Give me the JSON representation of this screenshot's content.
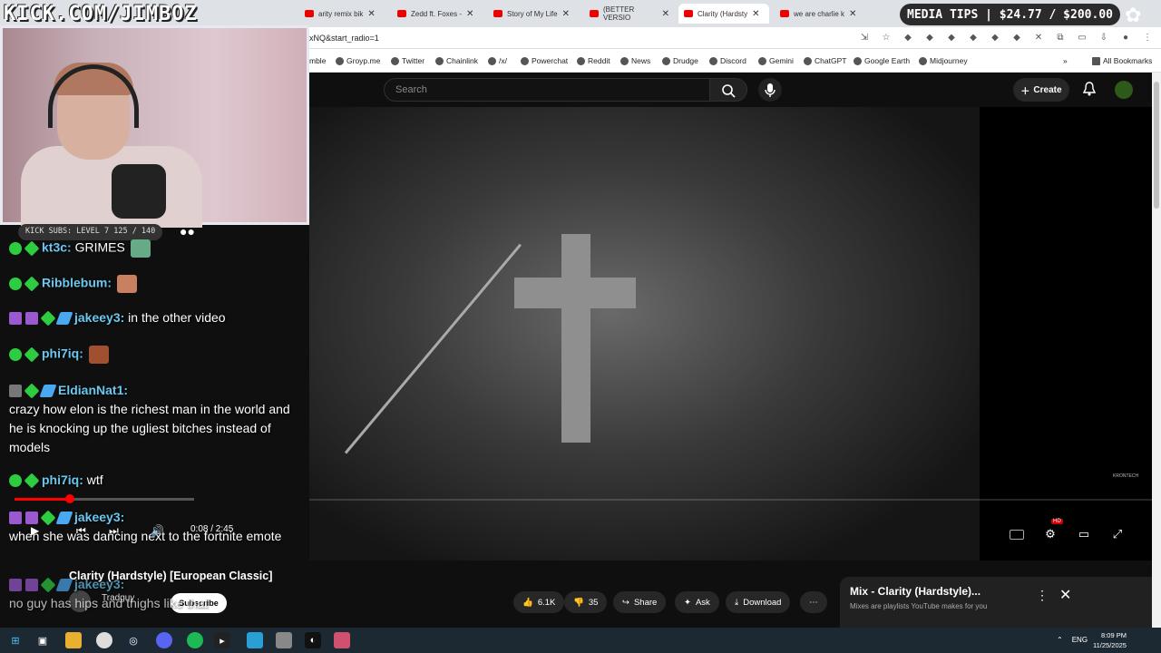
{
  "browser": {
    "tabs": [
      {
        "title": "arity remix bik",
        "active": false
      },
      {
        "title": "Zedd ft. Foxes -",
        "active": false
      },
      {
        "title": "Story of My Life",
        "active": false
      },
      {
        "title": "(BETTER VERSIO",
        "active": false
      },
      {
        "title": "Clarity (Hardsty",
        "active": true
      },
      {
        "title": "we are charlie k",
        "active": false
      }
    ],
    "url": "xNQ&start_radio=1",
    "bookmarks": [
      "mble",
      "Groyp.me",
      "Twitter",
      "Chainlink",
      "/x/",
      "Powerchat",
      "Reddit",
      "News",
      "Drudge",
      "Discord",
      "Gemini",
      "ChatGPT",
      "Google Earth",
      "Midjourney"
    ],
    "all_bookmarks": "All Bookmarks"
  },
  "overlay": {
    "kick_url": "KICK.COM/JIMBOZ",
    "media_tips": "MEDIA TIPS | $24.77 / $200.00",
    "subs_goal": "KICK SUBS: LEVEL 7 125 / 140"
  },
  "youtube": {
    "search_placeholder": "Search",
    "create_label": "Create",
    "video_title": "Clarity (Hardstyle) [European Classic]",
    "channel": "Tradguy",
    "subscribe": "Subscribe",
    "likes": "6.1K",
    "dislikes": "35",
    "share": "Share",
    "ask": "Ask",
    "download": "Download",
    "time": "0:08 / 2:45",
    "progress_fraction": 0.05,
    "hd_badge": "HD",
    "watermark": "KRONTECH"
  },
  "mix": {
    "title": "Mix - Clarity (Hardstyle)...",
    "subtitle": "Mixes are playlists YouTube makes for you"
  },
  "chat": [
    {
      "user": "kt3c:",
      "text": "GRIMES"
    },
    {
      "user": "Ribblebum:",
      "text": ""
    },
    {
      "user": "jakeey3:",
      "text": "in the other video"
    },
    {
      "user": "phi7iq:",
      "text": ""
    },
    {
      "user": "EldianNat1:",
      "text": "crazy how elon is the richest man in the world and he is knocking up the ugliest bitches instead of models"
    },
    {
      "user": "phi7iq:",
      "text": "wtf"
    },
    {
      "user": "jakeey3:",
      "text": "when she was dancing next to the fortnite emote"
    },
    {
      "user": "jakeey3:",
      "text": "no guy has hips and thighs like that"
    }
  ],
  "taskbar": {
    "lang": "ENG",
    "time": "8:09 PM",
    "date": "11/25/2025"
  }
}
